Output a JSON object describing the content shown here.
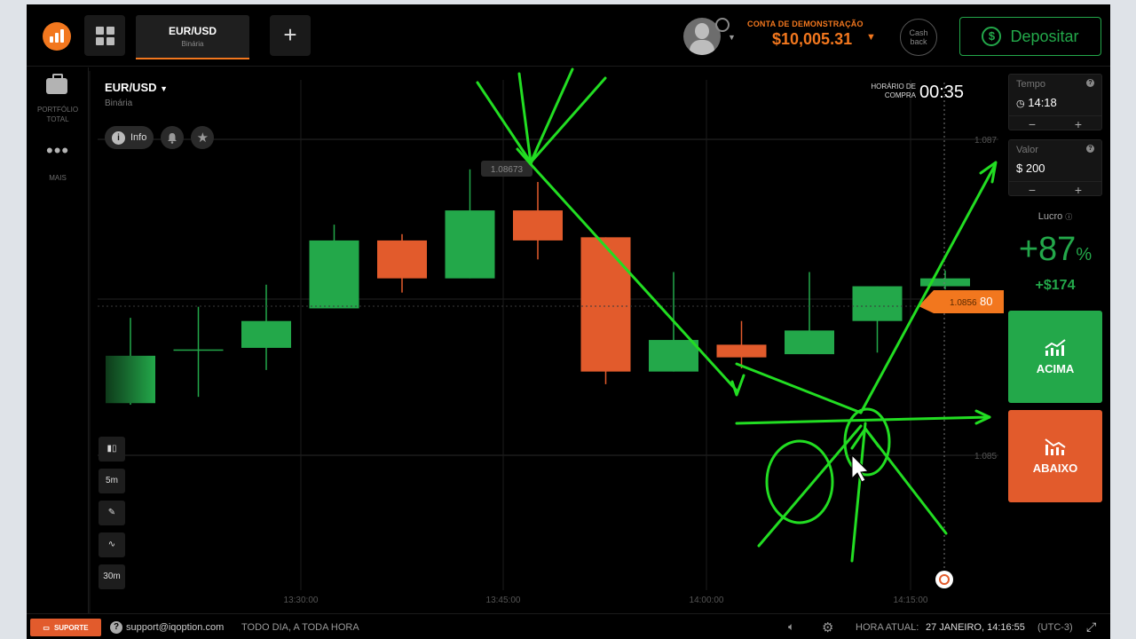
{
  "header": {
    "asset_tab_title": "EUR/USD",
    "asset_tab_subtitle": "Binária",
    "account_label": "CONTA DE DEMONSTRAÇÃO",
    "account_balance": "$10,005.31",
    "cashback_line1": "Cash",
    "cashback_line2": "back",
    "deposit_label": "Depositar"
  },
  "sidebar": {
    "portfolio_line1": "PORTFÓLIO",
    "portfolio_line2": "TOTAL",
    "more_label": "MAIS"
  },
  "chart": {
    "pair_title": "EUR/USD",
    "pair_subtitle": "Binária",
    "info_label": "Info",
    "purchase_time_line1": "HORÁRIO DE",
    "purchase_time_line2": "COMPRA",
    "countdown": "00:35",
    "high_price_label": "1.08673",
    "current_price_label": "1.085680",
    "current_price_suffix": "80",
    "price_axis": [
      "1.087",
      "1.085"
    ],
    "time_axis": [
      "13:30:00",
      "13:45:00",
      "14:00:00",
      "14:15:00"
    ],
    "timeframes": [
      "5m",
      "30m"
    ]
  },
  "chart_data": {
    "type": "candlestick",
    "ylim": [
      1.0842,
      1.0874
    ],
    "y_ticks": [
      1.087,
      1.085
    ],
    "x_ticks": [
      "13:30:00",
      "13:45:00",
      "14:00:00",
      "14:15:00"
    ],
    "candles": [
      {
        "open": 1.08533,
        "close": 1.08563,
        "high": 1.08587,
        "low": 1.08532,
        "dir": "up"
      },
      {
        "open": 1.08567,
        "close": 1.08567,
        "high": 1.08594,
        "low": 1.08537,
        "dir": "flat"
      },
      {
        "open": 1.08568,
        "close": 1.08585,
        "high": 1.08608,
        "low": 1.08554,
        "dir": "up"
      },
      {
        "open": 1.08593,
        "close": 1.08636,
        "high": 1.08646,
        "low": 1.08593,
        "dir": "up"
      },
      {
        "open": 1.08636,
        "close": 1.08612,
        "high": 1.0864,
        "low": 1.08603,
        "dir": "down"
      },
      {
        "open": 1.08612,
        "close": 1.08655,
        "high": 1.08681,
        "low": 1.08612,
        "dir": "up"
      },
      {
        "open": 1.08655,
        "close": 1.08636,
        "high": 1.08673,
        "low": 1.08624,
        "dir": "down"
      },
      {
        "open": 1.08638,
        "close": 1.08553,
        "high": 1.08638,
        "low": 1.08545,
        "dir": "down"
      },
      {
        "open": 1.08553,
        "close": 1.08573,
        "high": 1.08616,
        "low": 1.08553,
        "dir": "up"
      },
      {
        "open": 1.0857,
        "close": 1.08562,
        "high": 1.08585,
        "low": 1.08555,
        "dir": "down"
      },
      {
        "open": 1.08564,
        "close": 1.08579,
        "high": 1.08616,
        "low": 1.08564,
        "dir": "up"
      },
      {
        "open": 1.08585,
        "close": 1.08607,
        "high": 1.08607,
        "low": 1.08565,
        "dir": "up"
      },
      {
        "open": 1.08607,
        "close": 1.08612,
        "high": 1.08617,
        "low": 1.08605,
        "dir": "up"
      }
    ]
  },
  "right_panel": {
    "time_label": "Tempo",
    "time_value": "14:18",
    "amount_label": "Valor",
    "amount_value": "$ 200",
    "profit_label": "Lucro",
    "profit_percent": "+87",
    "profit_percent_sign": "%",
    "profit_amount": "+$174",
    "call_label": "ACIMA",
    "put_label": "ABAIXO",
    "minus": "−",
    "plus": "+"
  },
  "footer": {
    "support_label": "SUPORTE",
    "email": "support@iqoption.com",
    "hours": "TODO DIA, A TODA HORA",
    "current_time_label": "HORA ATUAL:",
    "current_time_value": "27 JANEIRO, 14:16:55",
    "timezone": "(UTC-3)"
  },
  "colors": {
    "brand_orange": "#f2771e",
    "up_green": "#23a84a",
    "down_red": "#e25b2c",
    "annotation_green": "#22dd22"
  }
}
